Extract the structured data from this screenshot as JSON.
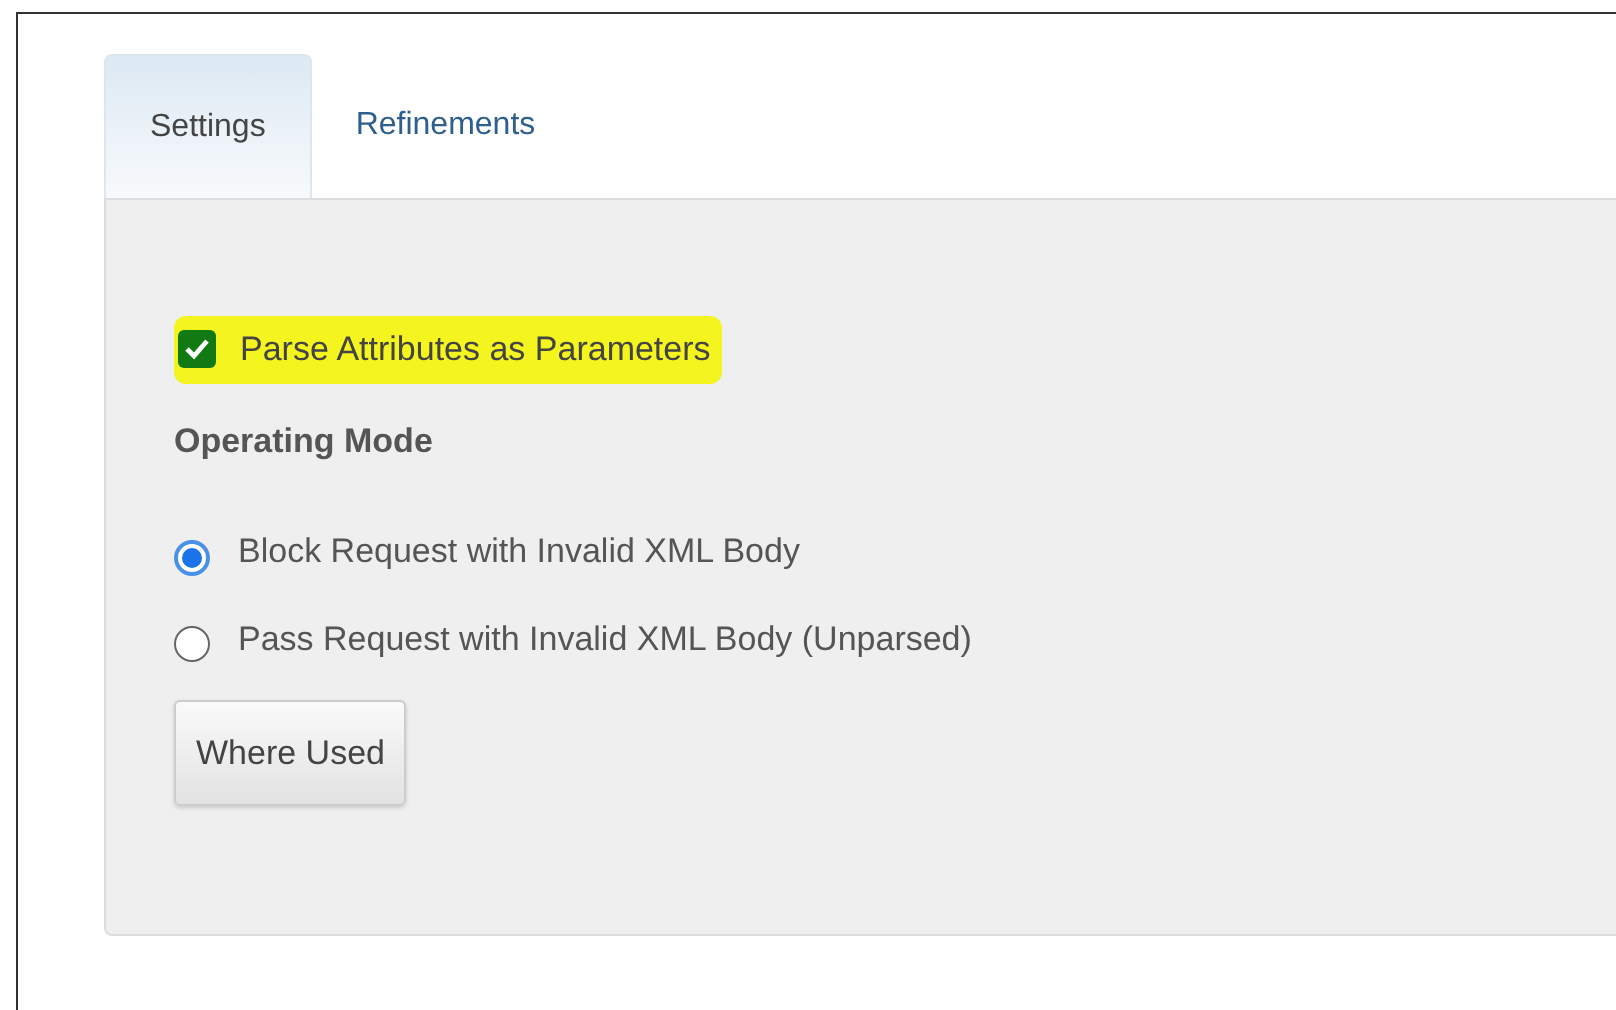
{
  "tabs": [
    {
      "label": "Settings",
      "selected": true
    },
    {
      "label": "Refinements",
      "selected": false
    }
  ],
  "checkbox": {
    "label": "Parse Attributes as Parameters",
    "checked": true,
    "highlighted": true
  },
  "section_title": "Operating Mode",
  "radios": [
    {
      "label": "Block Request with Invalid XML Body",
      "selected": true
    },
    {
      "label": "Pass Request with Invalid XML Body (Unparsed)",
      "selected": false
    }
  ],
  "button": "Where Used"
}
